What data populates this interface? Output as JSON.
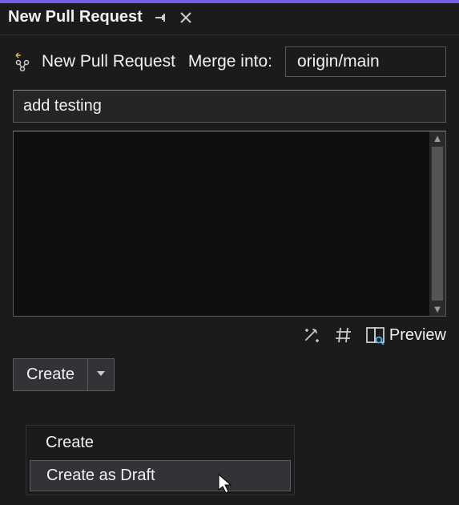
{
  "window": {
    "title": "New Pull Request"
  },
  "header": {
    "label": "New Pull Request",
    "merge_into_label": "Merge into:",
    "target_branch": "origin/main"
  },
  "form": {
    "title_value": "add testing",
    "description_value": ""
  },
  "toolbar": {
    "preview_label": "Preview"
  },
  "actions": {
    "create_label": "Create",
    "dropdown": {
      "create": "Create",
      "create_as_draft": "Create as Draft"
    }
  }
}
